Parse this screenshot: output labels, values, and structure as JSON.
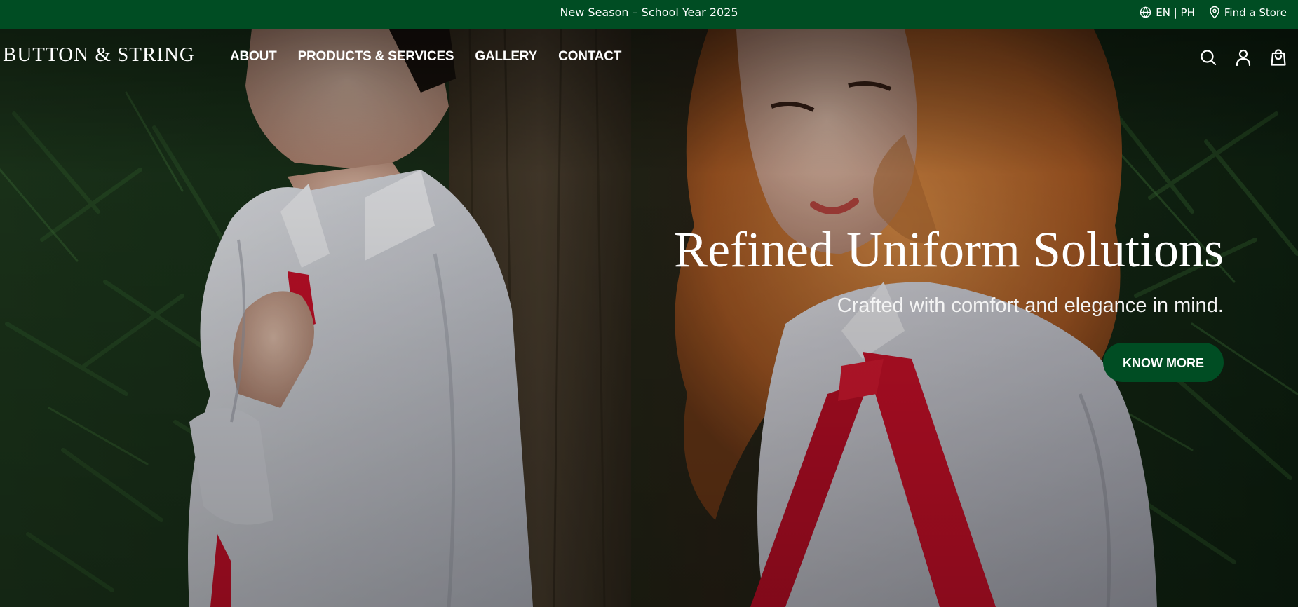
{
  "announcement": {
    "text": "New Season – School Year 2025"
  },
  "utility": {
    "language_label": "EN | PH",
    "store_label": "Find a Store",
    "language_icon": "globe-icon",
    "store_icon": "map-pin-icon"
  },
  "header": {
    "logo": "BUTTON & STRING",
    "nav": [
      {
        "label": "ABOUT"
      },
      {
        "label": "PRODUCTS & SERVICES"
      },
      {
        "label": "GALLERY"
      },
      {
        "label": "CONTACT"
      }
    ],
    "icons": [
      "search-icon",
      "account-icon",
      "shopping-bag-icon"
    ]
  },
  "hero": {
    "title": "Refined Uniform Solutions",
    "subtitle": "Crafted with comfort and elegance in mind.",
    "cta_label": "KNOW MORE"
  },
  "colors": {
    "brand_green": "#004d23",
    "text_white": "#ffffff",
    "tie_red": "#d2112b"
  }
}
